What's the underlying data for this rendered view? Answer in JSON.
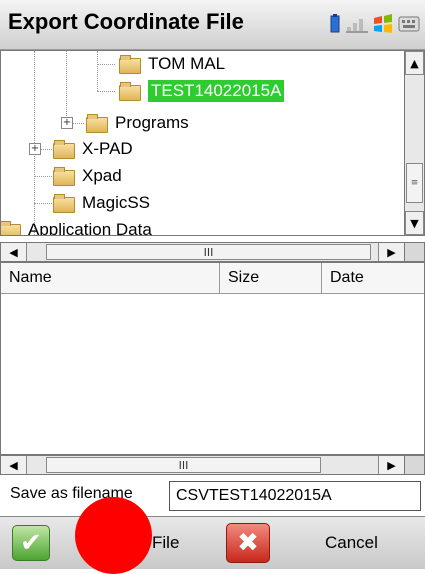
{
  "window": {
    "title": "Export Coordinate File",
    "tray_icons": [
      "battery-icon",
      "signal-icon",
      "windows-start-icon",
      "keyboard-icon"
    ]
  },
  "folder_tree": {
    "items": [
      {
        "label": "TOM MAL",
        "selected": false
      },
      {
        "label": "TEST14022015A",
        "selected": true
      },
      {
        "label": "Programs",
        "selected": false
      },
      {
        "label": "X-PAD",
        "selected": false
      },
      {
        "label": "Xpad",
        "selected": false
      },
      {
        "label": "MagicSS",
        "selected": false
      },
      {
        "label": "Application Data",
        "selected": false
      }
    ]
  },
  "scroll": {
    "grip": "III",
    "up": "▲",
    "down": "▼",
    "left": "◀",
    "right": "▶",
    "vgrip": "≡"
  },
  "file_list": {
    "columns": [
      "Name",
      "Size",
      "Date"
    ],
    "rows": []
  },
  "save": {
    "label": "Save as filename",
    "value": "CSVTEST14022015A"
  },
  "buttons": {
    "ok_glyph": "✔",
    "file_label": "File",
    "cancel_glyph": "✖",
    "cancel_label": "Cancel"
  },
  "colors": {
    "selection": "#2ecc2e",
    "annotation_marker": "#ff0000"
  }
}
